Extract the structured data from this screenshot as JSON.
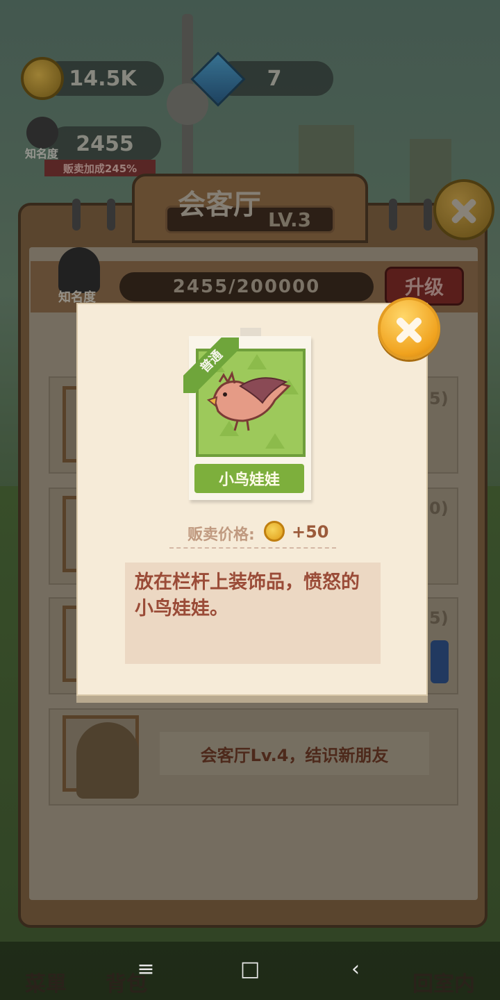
{
  "hud": {
    "coins": "14.5K",
    "gems": "7",
    "fame_value": "2455",
    "fame_label": "知名度",
    "sell_bonus": "贩卖加成245%"
  },
  "room_panel": {
    "title": "会客厅",
    "level": "LV.3",
    "fame_label": "知名度",
    "progress_text": "2455/200000",
    "upgrade_label": "升级",
    "side_values": [
      "5)",
      "0)",
      "5)"
    ],
    "unlock_message": "会客厅Lv.4，结识新朋友"
  },
  "item_dialog": {
    "rarity": "普通",
    "item_name": "小鸟娃娃",
    "price_label": "贩卖价格:",
    "price_value": "+50",
    "description": "放在栏杆上装饰品，愤怒的小鸟娃娃。"
  },
  "bottom_nav": {
    "menu_label": "菜單",
    "bag_label": "背包",
    "home_label": "回室内"
  },
  "system_nav": {
    "menu_symbol": "≡",
    "home_symbol": "□",
    "back_symbol": "‹"
  },
  "icons": {
    "coin": "coin-icon",
    "gem": "gem-icon",
    "close": "close-icon"
  },
  "colors": {
    "dialog_bg": "#f6ebd8",
    "close_button": "#f0a21e",
    "item_green": "#7daf3c",
    "description_text": "#9a4b37"
  }
}
